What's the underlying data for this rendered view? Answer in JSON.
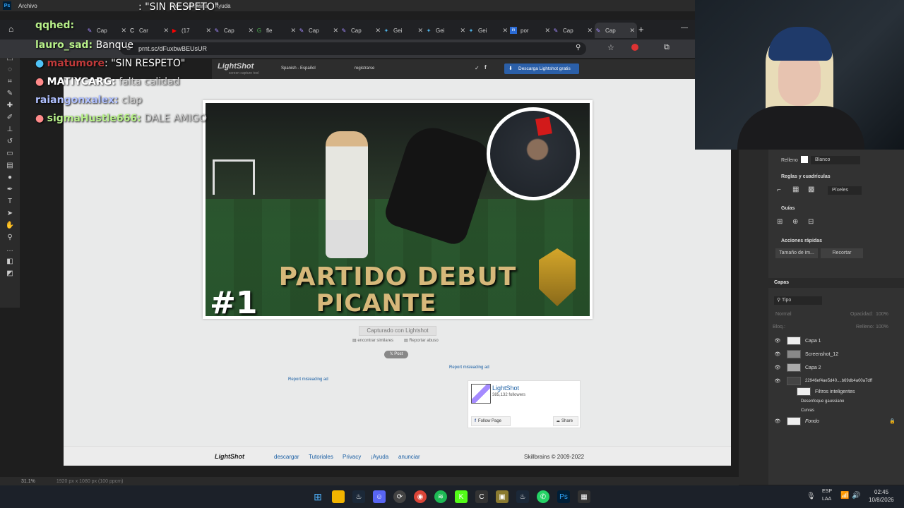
{
  "ps_menu": {
    "items": [
      "Archivo",
      "Ver",
      "Ventana",
      "Ayuda"
    ]
  },
  "browser": {
    "tabs": [
      "Cap",
      "Car",
      "(17",
      "Cap",
      "fle",
      "Cap",
      "Cap",
      "Gei",
      "Gei",
      "Gei",
      "por",
      "Cap",
      "Cap"
    ],
    "url": "prnt.sc/dFuxbwBEUsUR"
  },
  "lightshot": {
    "brand": "LightShot",
    "tagline": "screen capture tool",
    "language": "Spanish - Español",
    "register": "registrarse",
    "download_btn": "Descarga Lightshot gratis",
    "image": {
      "title_line1": "PARTIDO DEBUT",
      "title_line2": "PICANTE",
      "number": "#1"
    },
    "captured": "Capturado con Lightshot",
    "find_similar": "encontrar similares",
    "report_abuse": "Reportar abuso",
    "post": "Post",
    "report_misleading_1": "Report misleading ad",
    "report_misleading_2": "Report misleading ad",
    "fb_name": "LightShot",
    "fb_followers": "385,132 followers",
    "fb_follow": "Follow Page",
    "fb_share": "Share",
    "footer": {
      "logo": "LightShot",
      "links": [
        "descargar",
        "Tutoriales",
        "Privacy",
        "¡Ayuda",
        "anunciar"
      ],
      "copyright": "Skillbrains © 2009-2022"
    }
  },
  "chat": [
    {
      "user": "",
      "msg": ": \"SIN RESPETO\"",
      "color": "#ffffff"
    },
    {
      "user": "qqhed:",
      "msg": "",
      "color": "#b8f08a"
    },
    {
      "user": "lauro_sad:",
      "msg": "Banque",
      "color": "#b8f08a"
    },
    {
      "user": "matumore",
      "msg": ": \"SIN RESPETO\"",
      "color": "#c03a3a"
    },
    {
      "user": "MATIYCARG:",
      "msg": "falta calidad",
      "color": "#ffffff"
    },
    {
      "user": "raiangonxalex:",
      "msg": "clap",
      "color": "#b0c0ff"
    },
    {
      "user": "sigmaHustle666:",
      "msg": "DALE AMIGO",
      "color": "#b8f08a"
    }
  ],
  "ps_panels": {
    "fill_label": "Relleno",
    "fill_value": "Blanco",
    "rulers_title": "Reglas y cuadrículas",
    "units": "Píxeles",
    "guides_title": "Guías",
    "quick_actions_title": "Acciones rápidas",
    "image_size_btn": "Tamaño de im...",
    "crop_btn": "Recortar",
    "layers_title": "Capas",
    "filter_type": "Tipo",
    "blend_mode": "Normal",
    "opacity_label": "Opacidad:",
    "opacity_value": "100%",
    "lock_label": "Bloq.:",
    "fill2_label": "Relleno:",
    "fill2_value": "100%",
    "layers": [
      "Capa 1",
      "Screenshot_12",
      "Capa 2",
      "22946ef4ae5d40....b69db4a00a7dff",
      "Filtros inteligentes",
      "Desenfoque gaussiano",
      "Curvas",
      "Fondo"
    ]
  },
  "ps_status": {
    "zoom": "31.1%",
    "doc_info": "1920 px x 1080 px (100 ppcm)"
  },
  "taskbar": {
    "lang1": "ESP",
    "lang2": "LAA",
    "time": "02:45",
    "date": "10/8/2026"
  }
}
